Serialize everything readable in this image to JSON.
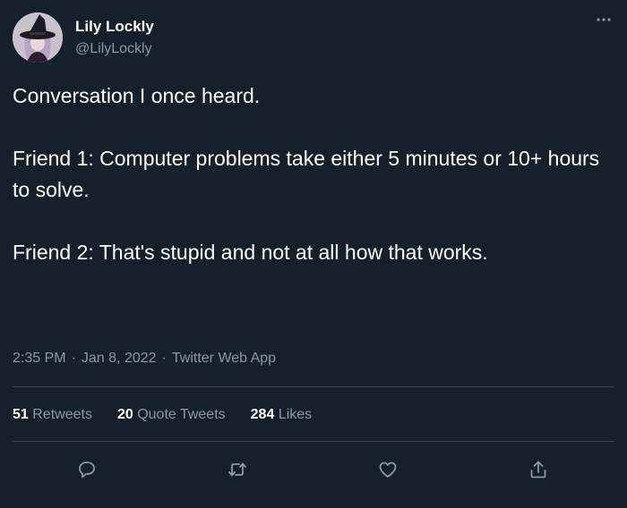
{
  "author": {
    "display_name": "Lily Lockly",
    "handle": "@LilyLockly"
  },
  "tweet": {
    "paragraphs": [
      "Conversation I once heard.",
      "Friend 1: Computer problems take either 5 minutes or 10+ hours to solve.",
      "Friend 2: That's stupid and not at all how that works."
    ],
    "time": "2:35 PM",
    "date": "Jan 8, 2022",
    "source": "Twitter Web App",
    "separator": "·"
  },
  "stats": [
    {
      "count": "51",
      "label": "Retweets"
    },
    {
      "count": "20",
      "label": "Quote Tweets"
    },
    {
      "count": "284",
      "label": "Likes"
    }
  ],
  "actions": [
    {
      "icon": "reply-icon"
    },
    {
      "icon": "retweet-icon"
    },
    {
      "icon": "like-icon"
    },
    {
      "icon": "share-icon"
    }
  ],
  "colors": {
    "background": "#15202b",
    "text": "#ffffff",
    "secondary_text": "#8b98a5",
    "divider": "#38444d"
  }
}
